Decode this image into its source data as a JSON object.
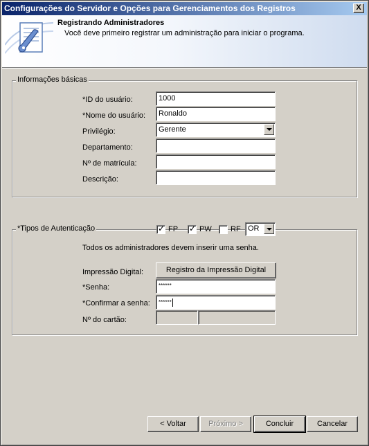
{
  "window": {
    "title": "Configurações do Servidor e Opções para Gerenciamentos dos Registros",
    "close_label": "X"
  },
  "banner": {
    "title": "Registrando Administradores",
    "subtitle": "Você deve primeiro registrar um administração para iniciar o programa.",
    "icon": "wrench-document-icon"
  },
  "basic": {
    "legend": "Informações básicas",
    "user_id_label": "*ID do usuário:",
    "user_id_value": "1000",
    "user_name_label": "*Nome do usuário:",
    "user_name_value": "Ronaldo",
    "privilege_label": "Privilégio:",
    "privilege_value": "Gerente",
    "department_label": "Departamento:",
    "department_value": "",
    "enrollment_label": "Nº de matrícula:",
    "enrollment_value": "",
    "description_label": "Descrição:",
    "description_value": ""
  },
  "auth": {
    "legend": "*Tipos de Autenticação",
    "fp_label": "FP",
    "fp_checked": true,
    "pw_label": "PW",
    "pw_checked": true,
    "rf_label": "RF",
    "rf_checked": false,
    "mode_value": "OR",
    "notice": "Todos os administradores devem inserir uma senha.",
    "fingerprint_label": "Impressão Digital:",
    "fingerprint_button": "Registro da Impressão Digital",
    "password_label": "*Senha:",
    "password_value": "******",
    "confirm_label": "*Confirmar a senha:",
    "confirm_value": "******",
    "card_label": "Nº do cartão:"
  },
  "footer": {
    "back": "< Voltar",
    "next": "Próximo >",
    "finish": "Concluir",
    "cancel": "Cancelar"
  }
}
